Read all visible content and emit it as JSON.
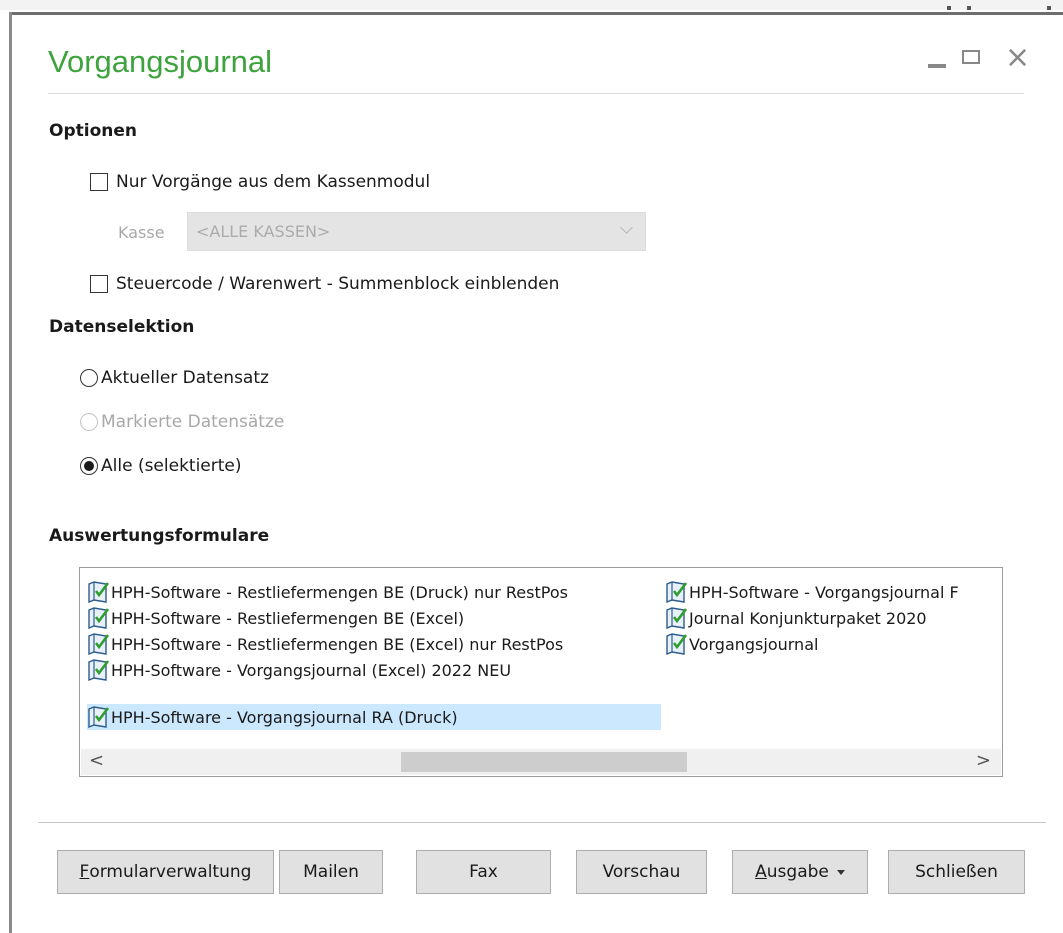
{
  "window": {
    "title": "Vorgangsjournal",
    "controls": {
      "minimize": "minimize-icon",
      "maximize": "maximize-icon",
      "close": "×"
    }
  },
  "options": {
    "heading": "Optionen",
    "only_cash_module": {
      "label": "Nur Vorgänge aus dem Kassenmodul",
      "checked": false
    },
    "kasse": {
      "label": "Kasse",
      "value": "<ALLE KASSEN>",
      "enabled": false
    },
    "tax_block": {
      "label": "Steuercode / Warenwert - Summenblock einblenden",
      "checked": false
    }
  },
  "data_selection": {
    "heading": "Datenselektion",
    "radios": [
      {
        "label": "Aktueller Datensatz",
        "checked": false,
        "enabled": true
      },
      {
        "label": "Markierte Datensätze",
        "checked": false,
        "enabled": false
      },
      {
        "label": "Alle (selektierte)",
        "checked": true,
        "enabled": true
      }
    ]
  },
  "forms": {
    "heading": "Auswertungsformulare",
    "items": [
      "HPH-Software - Restliefermengen BE (Druck) nur RestPos",
      "HPH-Software - Restliefermengen BE (Excel)",
      "HPH-Software - Restliefermengen BE (Excel) nur RestPos",
      "HPH-Software - Vorgangsjournal (Excel) 2022 NEU",
      "HPH-Software - Vorgangsjournal RA (Druck)",
      "HPH-Software - Vorgangsjournal F",
      "Journal Konjunkturpaket 2020",
      "Vorgangsjournal"
    ],
    "selected_index": 4,
    "scroll_left": "<",
    "scroll_right": ">"
  },
  "buttons": {
    "formularverwaltung_first": "F",
    "formularverwaltung_rest": "ormularverwaltung",
    "mailen": "Mailen",
    "fax": "Fax",
    "vorschau": "Vorschau",
    "ausgabe_first": "A",
    "ausgabe_rest": "usgabe",
    "schliessen": "Schließen"
  },
  "colors": {
    "title": "#3da33d",
    "selection": "#cce8ff",
    "button_bg": "#e1e1e1"
  }
}
